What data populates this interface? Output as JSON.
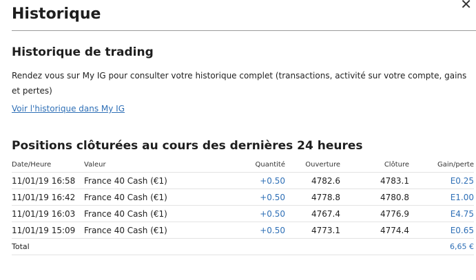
{
  "header": {
    "title": "Historique",
    "close_icon": "close-icon"
  },
  "trading": {
    "title": "Historique de trading",
    "description": "Rendez vous sur My IG pour consulter votre historique complet (transactions, activité sur votre compte, gains et pertes)",
    "link": "Voir l'historique dans My IG"
  },
  "positions": {
    "title": "Positions clôturées au cours des dernières 24 heures",
    "columns": [
      "Date/Heure",
      "Valeur",
      "Quantité",
      "Ouverture",
      "Clôture",
      "Gain/perte"
    ],
    "rows": [
      [
        "11/01/19 16:58",
        "France 40 Cash (€1)",
        "+0.50",
        "4782.6",
        "4783.1",
        "E0.25"
      ],
      [
        "11/01/19 16:42",
        "France 40 Cash (€1)",
        "+0.50",
        "4778.8",
        "4780.8",
        "E1.00"
      ],
      [
        "11/01/19 16:03",
        "France 40 Cash (€1)",
        "+0.50",
        "4767.4",
        "4776.9",
        "E4.75"
      ],
      [
        "11/01/19 15:09",
        "France 40 Cash (€1)",
        "+0.50",
        "4773.1",
        "4774.4",
        "E0.65"
      ]
    ],
    "total_label": "Total",
    "total_value": "6,65 €"
  },
  "colors": {
    "link": "#2e6fb6",
    "divider": "#9a9a9a"
  }
}
